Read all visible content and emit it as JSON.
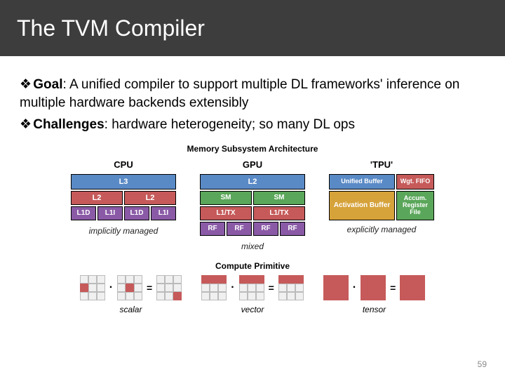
{
  "title": "The TVM Compiler",
  "bullets": {
    "goal_label": "Goal",
    "goal_text": ": A unified compiler to support multiple DL frameworks' inference on multiple hardware backends extensibly",
    "challenges_label": "Challenges",
    "challenges_text": ": hardware heterogeneity; so many DL ops"
  },
  "memory": {
    "title": "Memory Subsystem Architecture",
    "cpu": {
      "label": "CPU",
      "l3": "L3",
      "l2": "L2",
      "l1d": "L1D",
      "l1i": "L1I",
      "caption": "implicitly managed"
    },
    "gpu": {
      "label": "GPU",
      "l2": "L2",
      "sm": "SM",
      "l1tx": "L1/TX",
      "rf": "RF",
      "caption": "mixed"
    },
    "tpu": {
      "label": "'TPU'",
      "unified": "Unified Buffer",
      "wgt": "Wgt. FIFO",
      "act": "Activation Buffer",
      "acc": "Accum. Register File",
      "caption": "explicitly managed"
    }
  },
  "compute": {
    "title": "Compute Primitive",
    "scalar": "scalar",
    "vector": "vector",
    "tensor": "tensor"
  },
  "page": "59"
}
